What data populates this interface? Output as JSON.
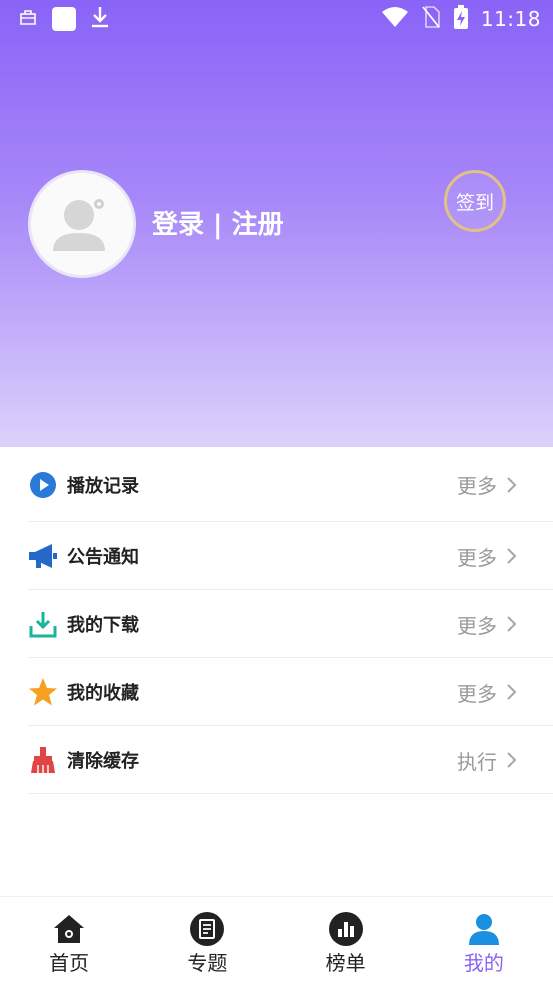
{
  "status_bar": {
    "time": "11:18",
    "icons": [
      "briefcase-icon",
      "app-square-icon",
      "download-icon",
      "wifi-icon",
      "no-sim-icon",
      "battery-charging-icon"
    ]
  },
  "profile": {
    "login_label": "登录 | 注册",
    "checkin_label": "签到",
    "avatar_icon": "default-avatar-icon"
  },
  "menu": {
    "items": [
      {
        "label": "播放记录",
        "action": "更多",
        "icon": "play-circle-icon",
        "color": "#2979d9"
      },
      {
        "label": "公告通知",
        "action": "更多",
        "icon": "megaphone-icon",
        "color": "#2469c8"
      },
      {
        "label": "我的下载",
        "action": "更多",
        "icon": "download-tray-icon",
        "color": "#1bb39a"
      },
      {
        "label": "我的收藏",
        "action": "更多",
        "icon": "star-icon",
        "color": "#f5a020"
      },
      {
        "label": "清除缓存",
        "action": "执行",
        "icon": "broom-icon",
        "color": "#e04545"
      }
    ]
  },
  "tabbar": {
    "tabs": [
      {
        "label": "首页",
        "icon": "home-icon"
      },
      {
        "label": "专题",
        "icon": "topic-icon"
      },
      {
        "label": "榜单",
        "icon": "ranking-icon"
      },
      {
        "label": "我的",
        "icon": "profile-icon",
        "active": true
      }
    ]
  },
  "colors": {
    "accent": "#8a63f7",
    "header_top": "#8a63f7",
    "header_bottom": "#dcd1fb",
    "checkin_border": "#e0c285"
  }
}
